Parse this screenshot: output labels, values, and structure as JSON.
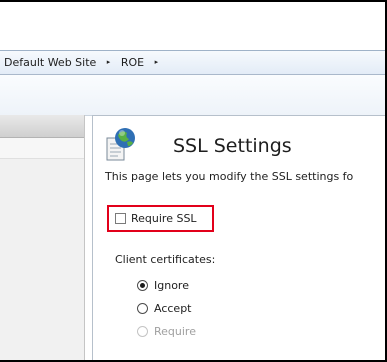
{
  "breadcrumb": {
    "items": [
      "Default Web Site",
      "ROE"
    ],
    "separator": "▸"
  },
  "feature": {
    "title": "SSL Settings",
    "description": "This page lets you modify the SSL settings fo",
    "icon": "ssl-settings-icon"
  },
  "require_ssl": {
    "label": "Require SSL",
    "checked": false,
    "highlight_color": "#e2001a"
  },
  "client_certificates": {
    "label": "Client certificates:",
    "options": [
      {
        "label": "Ignore",
        "selected": true,
        "enabled": true
      },
      {
        "label": "Accept",
        "selected": false,
        "enabled": true
      },
      {
        "label": "Require",
        "selected": false,
        "enabled": false
      }
    ]
  },
  "colors": {
    "address_bar": "#e3ecf7",
    "left_pane": "#f1f1f1"
  }
}
